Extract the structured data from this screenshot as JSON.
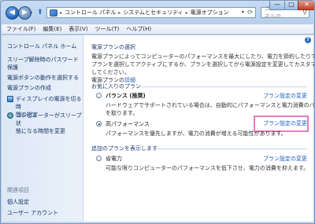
{
  "window": {
    "breadcrumb": [
      "コントロール パネル",
      "システムとセキュリティ",
      "電源オプション"
    ],
    "search_placeholder": "コントロール パネルの...",
    "controls": {
      "minimize": "—",
      "maximize": "□",
      "close": "✕"
    }
  },
  "menu": [
    "ファイル(F)",
    "編集(E)",
    "表示(V)",
    "ツール(T)",
    "ヘルプ(H)"
  ],
  "sidebar": {
    "home": "コントロール パネル ホーム",
    "items": [
      {
        "line1": "スリープ解除時のパスワード",
        "line2": "保護",
        "icon": null
      },
      {
        "line1": "電源ボタンの動作を選択する",
        "line2": "",
        "icon": null
      },
      {
        "line1": "電源プランの作成",
        "line2": "",
        "icon": null
      },
      {
        "line1": "ディスプレイの電源を切る時",
        "line2": "間の指定",
        "icon": "monitor-icon"
      },
      {
        "line1": "コンピューターがスリープ状",
        "line2": "態になる時間を変更",
        "icon": "globe-icon"
      }
    ],
    "related_title": "関連項目",
    "related": [
      "個人設定",
      "ユーザー アカウント"
    ]
  },
  "main": {
    "heading": "電源プランの選択",
    "desc": [
      "電源プランによってコンピューターのパフォーマンスを最大にしたり、電力を節約したりできます。",
      "プランを選択してアクティブにするか、プランを選択してから電源設定を変更してカスタマイズ",
      "してください。"
    ],
    "desc_link_pre": "電源プランの",
    "desc_link": "詳細",
    "favorites_label": "お気に入りのプラン",
    "more_plans_label": "追加のプランを表示します",
    "change_link": "プラン設定の変更",
    "plans": [
      {
        "name": "バランス (推奨)",
        "bold": true,
        "selected": false,
        "desc": [
          "ハードウェアでサポートされている場合は、自動的にパフォーマンスと電力消費のバランス",
          "を取ります。"
        ]
      },
      {
        "name": "高パフォーマンス",
        "bold": false,
        "selected": true,
        "desc": [
          "パフォーマンスを優先しますが、電力の消費が増える可能性があります。"
        ]
      },
      {
        "name": "省電力",
        "bold": false,
        "selected": false,
        "desc": [
          "可能な限りコンピューターのパフォーマンスを低下させ、電力の消費を抑えます。"
        ]
      }
    ]
  }
}
